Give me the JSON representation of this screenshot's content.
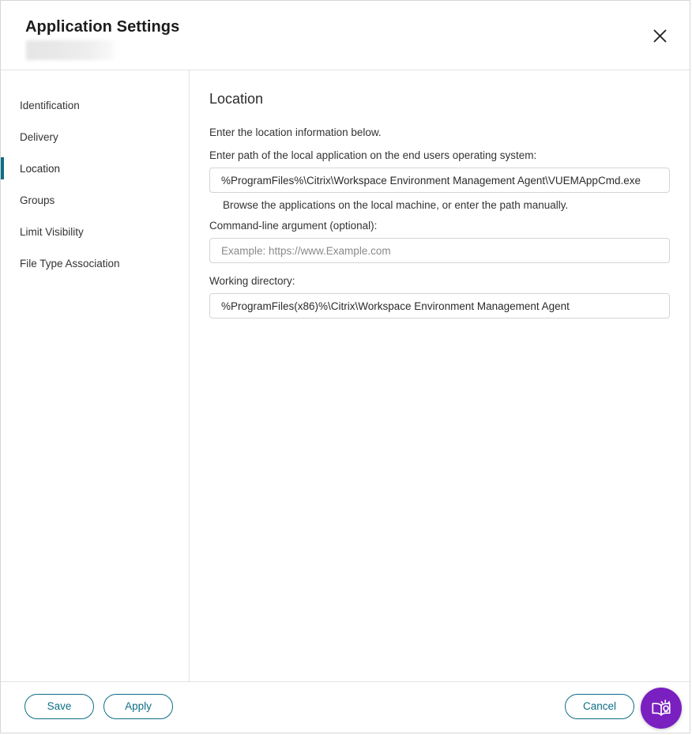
{
  "header": {
    "title": "Application Settings",
    "subtitle_redacted": true,
    "close_icon": "close-icon"
  },
  "sidebar": {
    "items": [
      {
        "label": "Identification",
        "active": false
      },
      {
        "label": "Delivery",
        "active": false
      },
      {
        "label": "Location",
        "active": true
      },
      {
        "label": "Groups",
        "active": false
      },
      {
        "label": "Limit Visibility",
        "active": false
      },
      {
        "label": "File Type Association",
        "active": false
      }
    ]
  },
  "content": {
    "section_title": "Location",
    "intro": "Enter the location information below.",
    "fields": [
      {
        "label": "Enter path of the local application on the end users operating system:",
        "value": "%ProgramFiles%\\Citrix\\Workspace Environment Management Agent\\VUEMAppCmd.exe",
        "placeholder": "",
        "hint": "Browse the applications on the local machine, or enter the path manually."
      },
      {
        "label": "Command-line argument (optional):",
        "value": "",
        "placeholder": "Example: https://www.Example.com",
        "hint": ""
      },
      {
        "label": "Working directory:",
        "value": "%ProgramFiles(x86)%\\Citrix\\Workspace Environment Management Agent",
        "placeholder": "",
        "hint": ""
      }
    ]
  },
  "footer": {
    "save_label": "Save",
    "apply_label": "Apply",
    "cancel_label": "Cancel",
    "help_icon": "book-lightbulb-icon"
  },
  "colors": {
    "accent_teal": "#0d6e86",
    "fab_purple": "#7a1fc0",
    "border": "#e3e3e3",
    "input_border": "#d4d4d4",
    "text": "#333333"
  }
}
